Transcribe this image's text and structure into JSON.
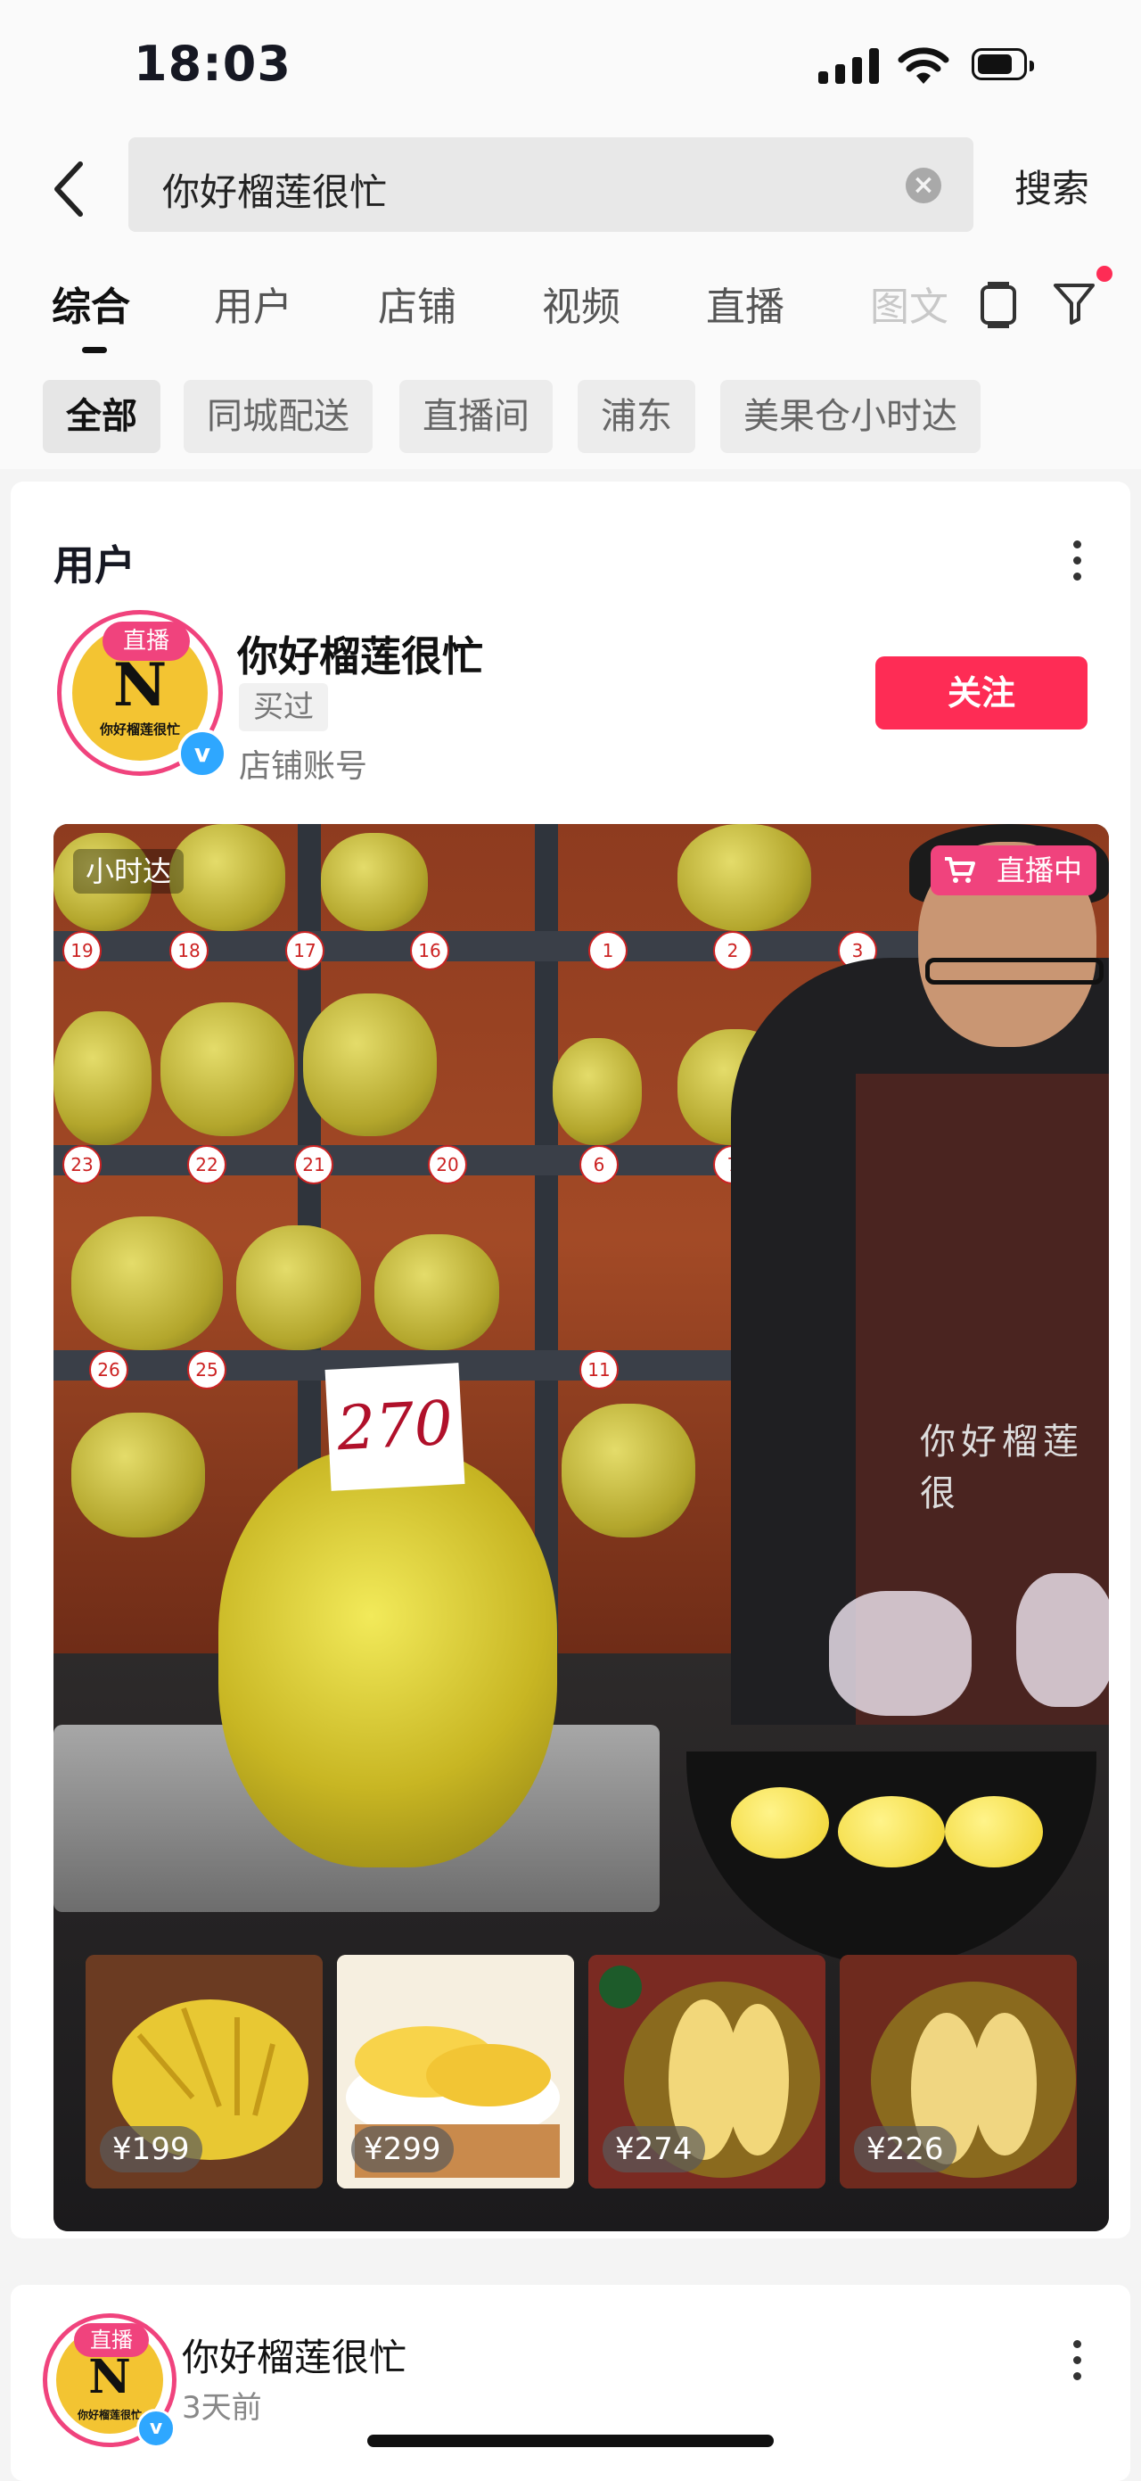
{
  "status_bar": {
    "time": "18:03"
  },
  "search": {
    "query": "你好榴莲很忙",
    "submit_label": "搜索"
  },
  "tabs": [
    {
      "label": "综合",
      "active": true
    },
    {
      "label": "用户"
    },
    {
      "label": "店铺"
    },
    {
      "label": "视频"
    },
    {
      "label": "直播"
    },
    {
      "label": "图文"
    }
  ],
  "chips": [
    {
      "label": "全部",
      "active": true
    },
    {
      "label": "同城配送"
    },
    {
      "label": "直播间"
    },
    {
      "label": "浦东"
    },
    {
      "label": "美果仓小时达"
    }
  ],
  "user_section": {
    "title": "用户",
    "account": {
      "name": "你好榴莲很忙",
      "avatar_letter": "N",
      "avatar_caption": "你好榴莲很忙",
      "avatar_badge": "直播",
      "verified_mark": "v",
      "tag": "买过",
      "subtitle": "店铺账号",
      "follow_label": "关注"
    },
    "live_preview": {
      "time_badge": "小时达",
      "live_badge": "直播中",
      "scale_price_card": "270",
      "apron_text": "你好榴莲很",
      "products": [
        {
          "price": "¥199"
        },
        {
          "price": "¥299"
        },
        {
          "price": "¥274"
        },
        {
          "price": "¥226"
        }
      ]
    }
  },
  "post": {
    "author": "你好榴莲很忙",
    "time": "3天前",
    "avatar_letter": "N",
    "avatar_caption": "你好榴莲很忙",
    "avatar_badge": "直播",
    "verified_mark": "v"
  },
  "colors": {
    "accent": "#fe2c55",
    "live_pink": "#f0437d",
    "verified_blue": "#2ea7ff"
  }
}
